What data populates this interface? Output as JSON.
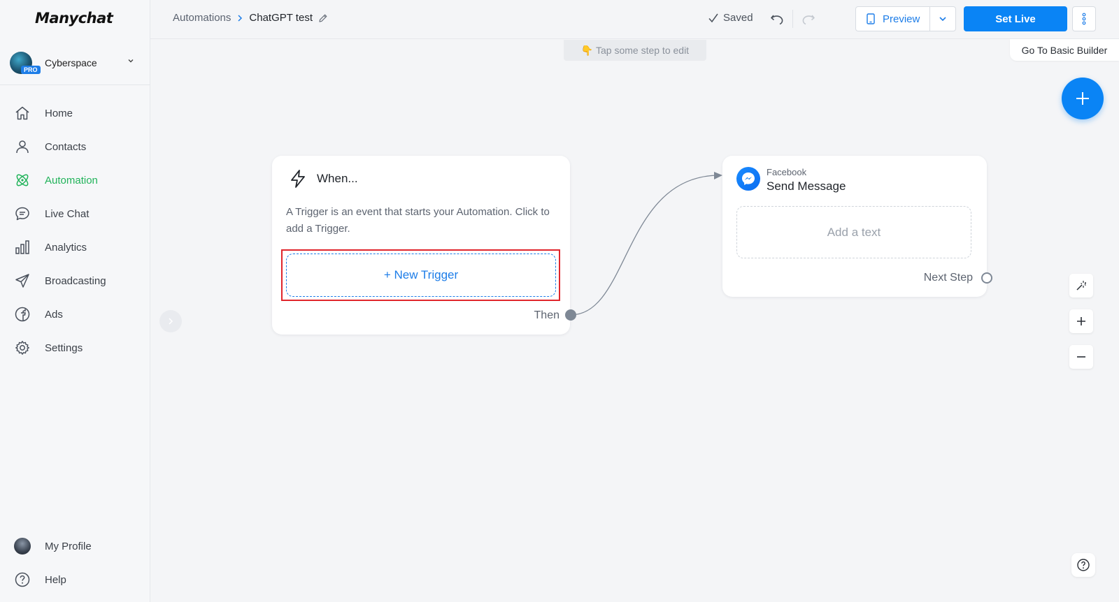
{
  "app": {
    "logo_text": "Manychat"
  },
  "workspace": {
    "name": "Cyberspace",
    "badge": "PRO"
  },
  "sidebar": {
    "items": [
      {
        "label": "Home",
        "icon": "home-icon"
      },
      {
        "label": "Contacts",
        "icon": "user-icon"
      },
      {
        "label": "Automation",
        "icon": "automation-icon",
        "active": true
      },
      {
        "label": "Live Chat",
        "icon": "chat-bubble-icon"
      },
      {
        "label": "Analytics",
        "icon": "bar-chart-icon"
      },
      {
        "label": "Broadcasting",
        "icon": "send-icon"
      },
      {
        "label": "Ads",
        "icon": "facebook-icon"
      },
      {
        "label": "Settings",
        "icon": "gear-icon"
      }
    ],
    "bottom": [
      {
        "label": "My Profile",
        "icon": "avatar"
      },
      {
        "label": "Help",
        "icon": "help-icon"
      }
    ]
  },
  "header": {
    "breadcrumb_parent": "Automations",
    "breadcrumb_current": "ChatGPT test",
    "status": "Saved",
    "preview_label": "Preview",
    "set_live_label": "Set Live"
  },
  "canvas": {
    "hint": "👇 Tap some step to edit",
    "basic_builder_label": "Go To Basic Builder",
    "trigger_card": {
      "title": "When...",
      "description": "A Trigger is an event that starts your Automation. Click to add a Trigger.",
      "button_label": "+ New Trigger",
      "then_label": "Then"
    },
    "message_card": {
      "channel": "Facebook",
      "title": "Send Message",
      "placeholder": "Add a text",
      "next_label": "Next Step"
    }
  },
  "colors": {
    "accent": "#0a84f5",
    "active_nav": "#21b35a",
    "highlight": "#e0262c"
  }
}
